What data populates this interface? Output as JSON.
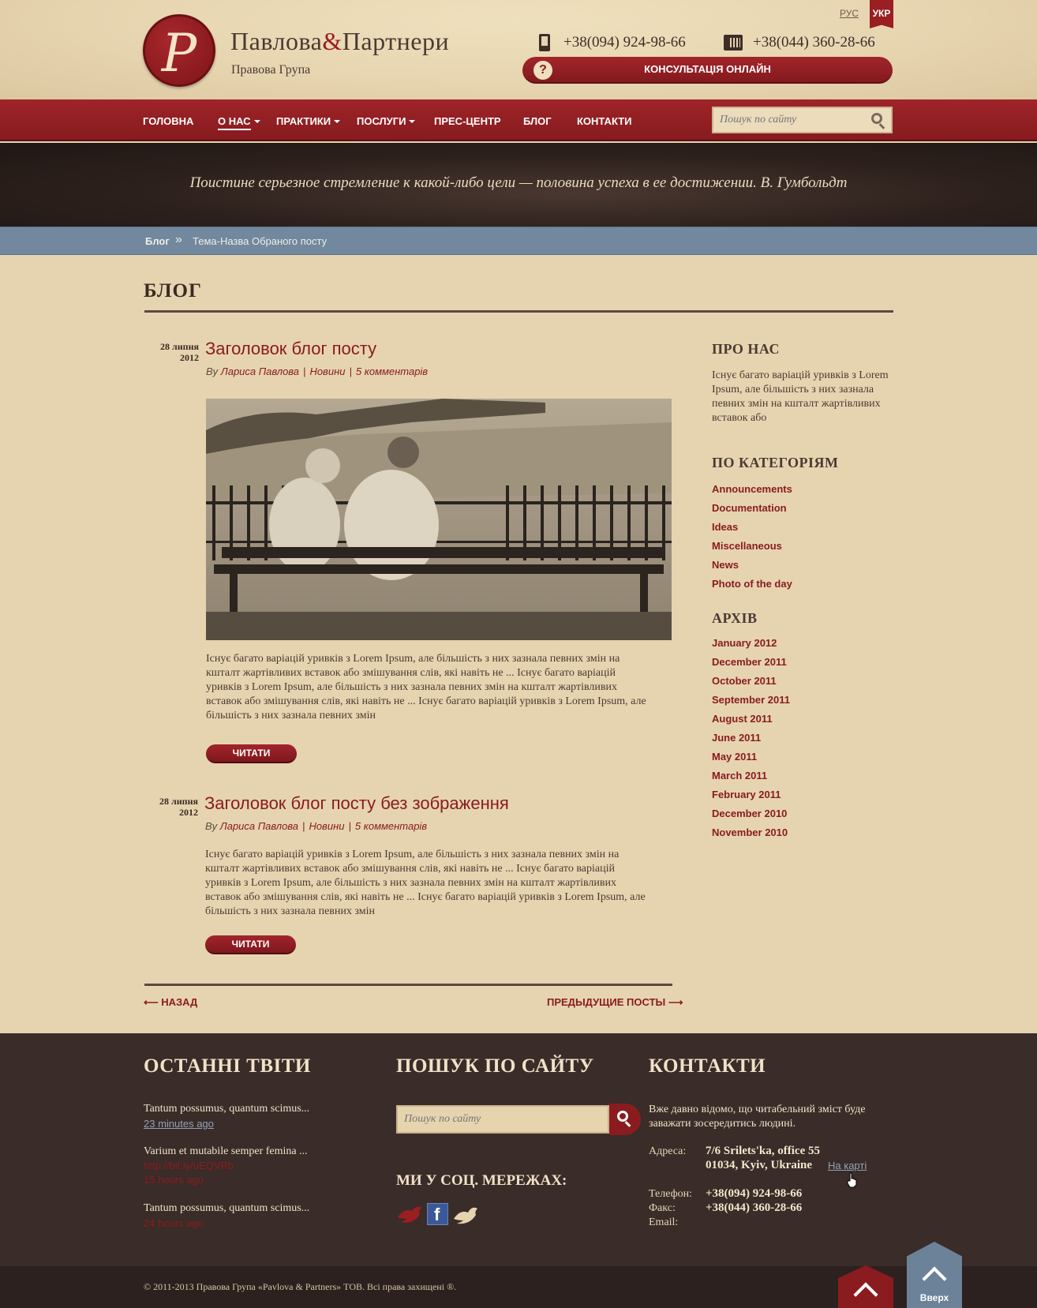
{
  "header": {
    "logo_letter": "P",
    "brand_first": "Павлова",
    "brand_amp": "&",
    "brand_second": "Партнери",
    "brand_sub": "Правова Група",
    "lang_ru": "РУС",
    "lang_uk": "УКР",
    "phone_mobile": "+38(094) 924-98-66",
    "phone_office": "+38(044) 360-28-66",
    "consult_label": "КОНСУЛЬТАЦІЯ ОНЛАЙН",
    "consult_icon": "?"
  },
  "nav": {
    "items": [
      {
        "label": "ГОЛОВНА"
      },
      {
        "label": "О НАС"
      },
      {
        "label": "ПРАКТИКИ"
      },
      {
        "label": "ПОСЛУГИ"
      },
      {
        "label": "ПРЕС-ЦЕНТР"
      },
      {
        "label": "БЛОГ"
      },
      {
        "label": "КОНТАКТИ"
      }
    ],
    "search_placeholder": "Пошук по сайту"
  },
  "hero": {
    "quote": "Поистине серьезное стремление к какой-либо цели — половина успеха в ее достижении. В.  Гумбольдт"
  },
  "breadcrumb": {
    "root": "Блог",
    "separator": "»",
    "current": "Тема-Назва Обраного посту"
  },
  "main": {
    "title": "БЛОГ",
    "posts": [
      {
        "date_day": "28 липня",
        "date_year": "2012",
        "title": "Заголовок блог посту",
        "by": "By",
        "author": "Лариса Павлова",
        "category": "Новини",
        "comments": "5 комментарів",
        "text": "Існує багато варіацій уривків з Lorem Ipsum, але більшість з них зазнала певних змін на кшталт жартівливих вставок або змішування слів, які навіть не ... Існує багато варіацій уривків з Lorem Ipsum, але більшість з них зазнала певних змін на кшталт жартівливих вставок або змішування слів, які навіть не ... Існує багато варіацій уривків з Lorem Ipsum, але більшість з них зазнала певних змін",
        "read_label": "ЧИТАТИ"
      },
      {
        "date_day": "28 липня",
        "date_year": "2012",
        "title": "Заголовок блог посту без зображення",
        "by": "By",
        "author": "Лариса Павлова",
        "category": "Новини",
        "comments": "5 комментарів",
        "text": "Існує багато варіацій уривків з Lorem Ipsum, але більшість з них зазнала певних змін на кшталт жартівливих вставок або змішування слів, які навіть не ... Існує багато варіацій уривків з Lorem Ipsum, але більшість з них зазнала певних змін на кшталт жартівливих вставок або змішування слів, які навіть не ... Існує багато варіацій уривків з Lorem Ipsum, але більшість з них зазнала певних змін",
        "read_label": "ЧИТАТИ"
      }
    ],
    "pager_back": "⟵ НАЗАД",
    "pager_prev": "ПРЕДЫДУЩИЕ ПОСТЫ ⟶"
  },
  "sidebar": {
    "about_title": "ПРО НАС",
    "about_text": "Існує багато варіацій уривків з Lorem Ipsum, але більшість з них зазнала певних змін на кшталт жартівливих вставок або",
    "categories_title": "ПО КАТЕГОРІЯМ",
    "categories": [
      "Announcements",
      "Documentation",
      "Ideas",
      "Miscellaneous",
      "News",
      "Photo of the day"
    ],
    "archive_title": "АРХІВ",
    "archive": [
      "January 2012",
      "December 2011",
      "October 2011",
      "September 2011",
      "August 2011",
      "June 2011",
      "May 2011",
      "March 2011",
      "February 2011",
      "December 2010",
      "November 2010"
    ]
  },
  "footer": {
    "tweets_title": "ОСТАННІ ТВІТИ",
    "tweets": [
      {
        "text": "Tantum possumus, quantum scimus...",
        "time": "23 minutes ago"
      },
      {
        "text": "Varium et mutabile semper femina ...",
        "link": "http://bit.ly/uEQVRb",
        "time": "15 hours ago"
      },
      {
        "text": "Tantum possumus, quantum scimus...",
        "time": "24 hours ago"
      }
    ],
    "search_title": "ПОШУК ПО САЙТУ",
    "search_placeholder": "Пошук по сайту",
    "social_title": "МИ У СОЦ. МЕРЕЖАХ:",
    "facebook_letter": "f",
    "contacts_title": "КОНТАКТИ",
    "contacts_text": "Вже давно відомо, що читабельний зміст буде заважати зосередитись людині.",
    "address_label": "Адреса:",
    "address_line1": "7/6 Srilets'ka, office 55",
    "address_line2": "01034, Kyiv, Ukraine",
    "map_link": "На карті",
    "phone_label": "Телефон:",
    "phone_value": "+38(094) 924-98-66",
    "fax_label": "Факс:",
    "fax_value": "+38(044) 360-28-66",
    "email_label": "Email:",
    "copyright": "© 2011-2013 Правова Група «Pavlova & Partners» ТОВ. Всі права захищені ®.",
    "up_label": "Вверх"
  },
  "colors": {
    "accent_red": "#8a1c20",
    "breadcrumb_blue": "#71889f",
    "footer_dark": "#3a2c28",
    "parchment": "#e6d4b0"
  }
}
